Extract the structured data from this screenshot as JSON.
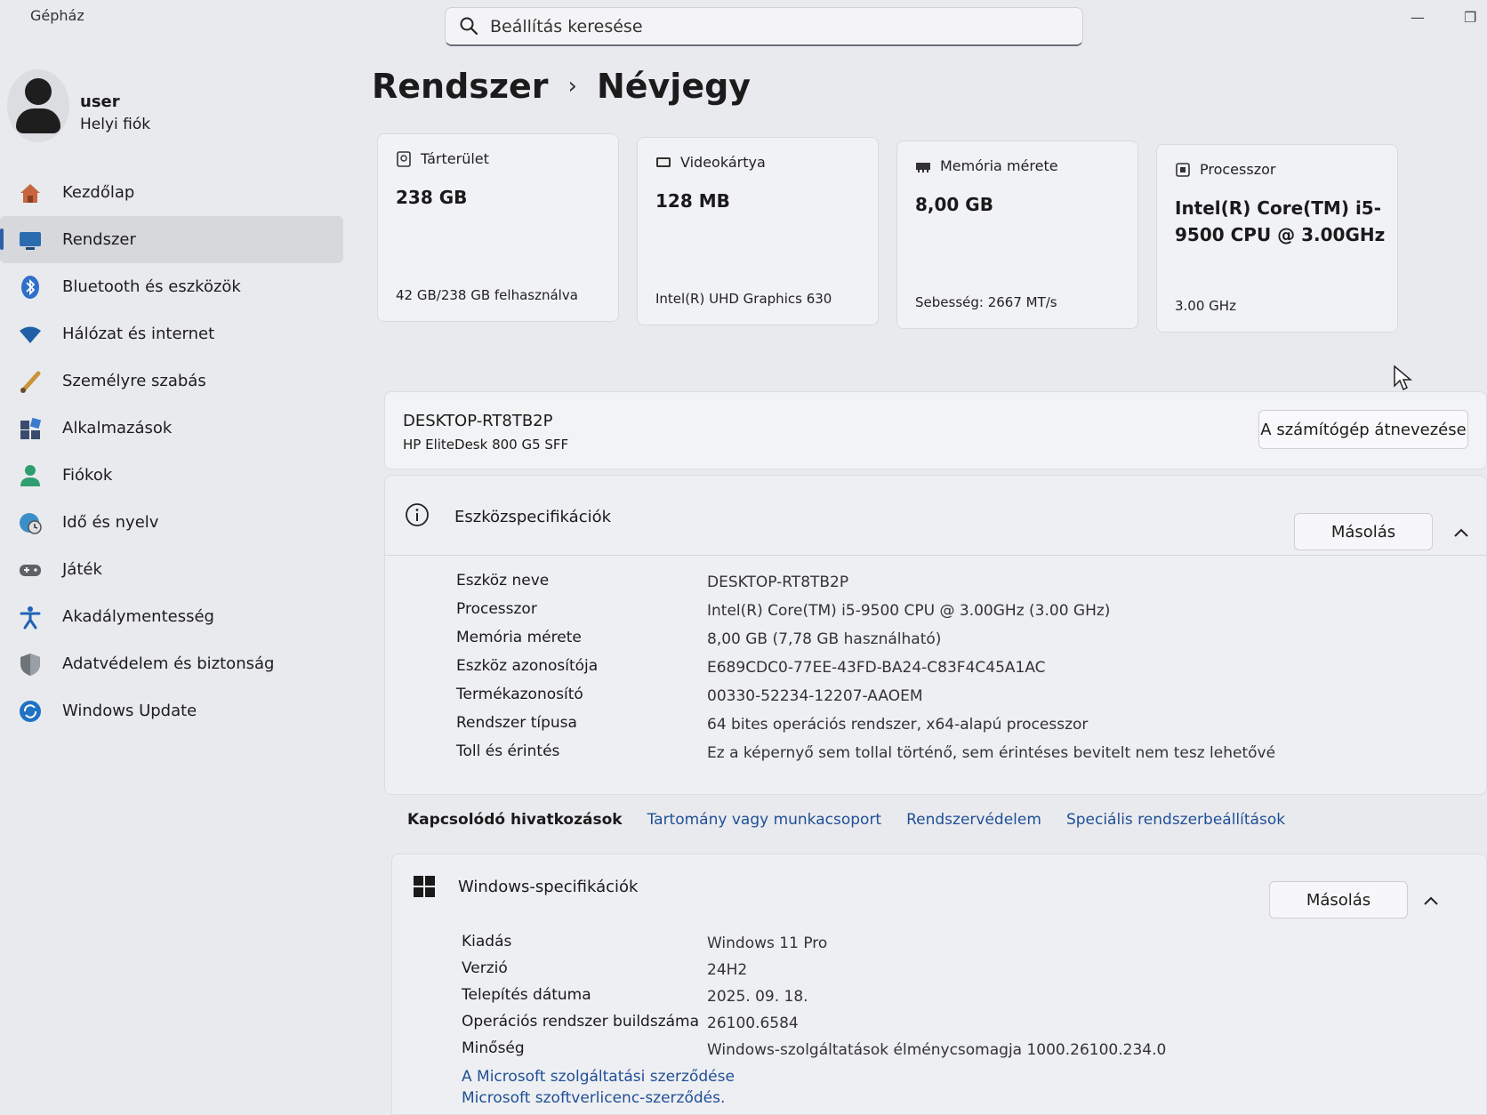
{
  "app": {
    "title": "Gépház",
    "search_placeholder": "Beállítás keresése"
  },
  "profile": {
    "name": "user",
    "account_type": "Helyi fiók"
  },
  "sidebar": {
    "items": [
      {
        "label": "Kezdőlap",
        "icon": "home-icon"
      },
      {
        "label": "Rendszer",
        "icon": "monitor-icon",
        "active": true
      },
      {
        "label": "Bluetooth és eszközök",
        "icon": "bluetooth-icon"
      },
      {
        "label": "Hálózat és internet",
        "icon": "wifi-icon"
      },
      {
        "label": "Személyre szabás",
        "icon": "brush-icon"
      },
      {
        "label": "Alkalmazások",
        "icon": "apps-icon"
      },
      {
        "label": "Fiókok",
        "icon": "person-icon"
      },
      {
        "label": "Idő és nyelv",
        "icon": "globe-clock-icon"
      },
      {
        "label": "Játék",
        "icon": "gamepad-icon"
      },
      {
        "label": "Akadálymentesség",
        "icon": "accessibility-icon"
      },
      {
        "label": "Adatvédelem és biztonság",
        "icon": "shield-icon"
      },
      {
        "label": "Windows Update",
        "icon": "update-icon"
      }
    ]
  },
  "breadcrumb": {
    "parent": "Rendszer",
    "separator": "›",
    "current": "Névjegy"
  },
  "cards": [
    {
      "title": "Tárterület",
      "value": "238 GB",
      "sub": "42 GB/238 GB felhasználva",
      "icon": "storage-icon"
    },
    {
      "title": "Videokártya",
      "value": "128 MB",
      "sub": "Intel(R) UHD Graphics 630",
      "icon": "gpu-icon"
    },
    {
      "title": "Memória mérete",
      "value": "8,00 GB",
      "sub": "Sebesség: 2667 MT/s",
      "icon": "memory-icon"
    },
    {
      "title": "Processzor",
      "value": "Intel(R) Core(TM) i5-9500 CPU @ 3.00GHz",
      "sub": "3.00 GHz",
      "icon": "cpu-icon"
    }
  ],
  "device": {
    "name": "DESKTOP-RT8TB2P",
    "model": "HP EliteDesk 800 G5 SFF",
    "rename_label": "A számítógép átnevezése"
  },
  "device_specs": {
    "title": "Eszközspecifikációk",
    "copy_label": "Másolás",
    "rows": [
      {
        "label": "Eszköz neve",
        "value": "DESKTOP-RT8TB2P"
      },
      {
        "label": "Processzor",
        "value": "Intel(R) Core(TM) i5-9500 CPU @ 3.00GHz (3.00 GHz)"
      },
      {
        "label": "Memória mérete",
        "value": "8,00 GB (7,78 GB használható)"
      },
      {
        "label": "Eszköz azonosítója",
        "value": "E689CDC0-77EE-43FD-BA24-C83F4C45A1AC"
      },
      {
        "label": "Termékazonosító",
        "value": "00330-52234-12207-AAOEM"
      },
      {
        "label": "Rendszer típusa",
        "value": "64 bites operációs rendszer, x64-alapú processzor"
      },
      {
        "label": "Toll és érintés",
        "value": "Ez a képernyő sem tollal történő, sem érintéses bevitelt nem tesz lehetővé"
      }
    ]
  },
  "related": {
    "title": "Kapcsolódó hivatkozások",
    "links": [
      "Tartomány vagy munkacsoport",
      "Rendszervédelem",
      "Speciális rendszerbeállítások"
    ]
  },
  "windows_specs": {
    "title": "Windows-specifikációk",
    "copy_label": "Másolás",
    "rows": [
      {
        "label": "Kiadás",
        "value": "Windows 11 Pro"
      },
      {
        "label": "Verzió",
        "value": "24H2"
      },
      {
        "label": "Telepítés dátuma",
        "value": "2025. 09. 18."
      },
      {
        "label": "Operációs rendszer buildszáma",
        "value": "26100.6584"
      },
      {
        "label": "Minőség",
        "value": "Windows-szolgáltatások élménycsomagja 1000.26100.234.0"
      }
    ],
    "links": [
      "A Microsoft szolgáltatási szerződése",
      "Microsoft szoftverlicenc-szerződés."
    ]
  },
  "colors": {
    "accent": "#2c5fa8",
    "link": "#1f4f95",
    "background": "#e9eaee"
  }
}
